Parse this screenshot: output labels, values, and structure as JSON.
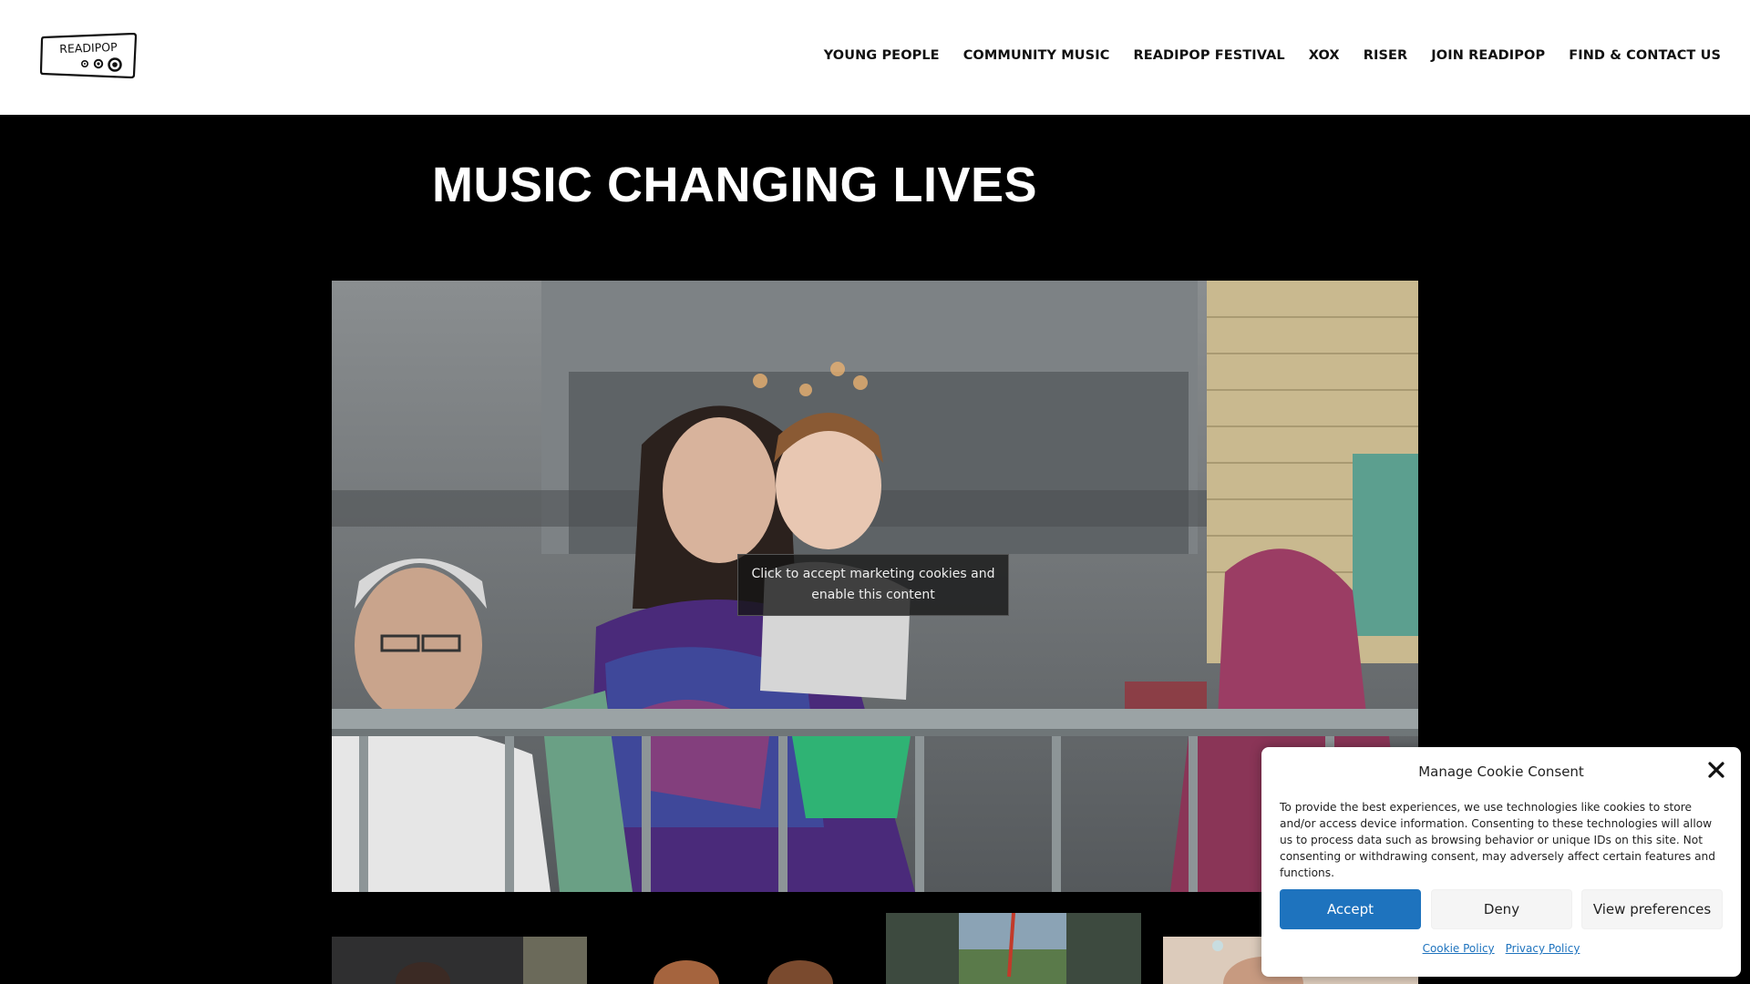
{
  "header": {
    "logo_text": "READIPOP",
    "nav": [
      "YOUNG PEOPLE",
      "COMMUNITY MUSIC",
      "READIPOP FESTIVAL",
      "XOX",
      "RISER",
      "JOIN READIPOP",
      "FIND & CONTACT US"
    ]
  },
  "main": {
    "title": "MUSIC CHANGING LIVES",
    "video": {
      "blocker_text": "Click to accept marketing cookies and enable this content"
    }
  },
  "cookie_consent": {
    "title": "Manage Cookie Consent",
    "body": "To provide the best experiences, we use technologies like cookies to store and/or access device information. Consenting to these technologies will allow us to process data such as browsing behavior or unique IDs on this site. Not consenting or withdrawing consent, may adversely affect certain features and functions.",
    "accept_label": "Accept",
    "deny_label": "Deny",
    "preferences_label": "View preferences",
    "cookie_policy_label": "Cookie Policy",
    "privacy_policy_label": "Privacy Policy",
    "accent_color": "#1e73be"
  },
  "icons": {
    "close": "close-icon",
    "logo": "cassette-logo-icon"
  }
}
